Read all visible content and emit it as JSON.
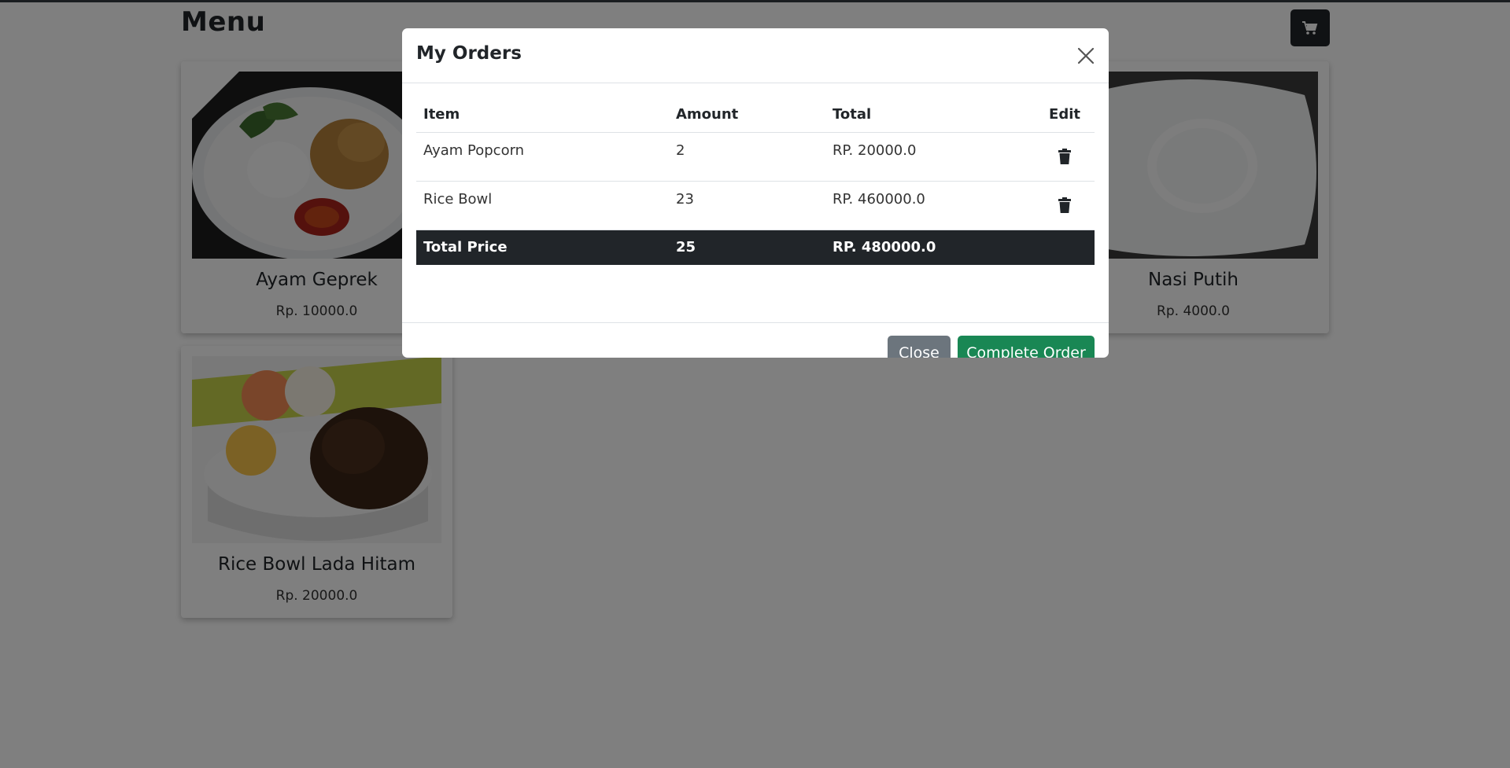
{
  "header": {
    "title": "Menu",
    "cart_icon": "cart-icon"
  },
  "menu_items": [
    {
      "name": "Ayam Geprek",
      "price": "Rp. 10000.0"
    },
    {
      "name": "Nasi Putih",
      "price": "Rp. 4000.0"
    },
    {
      "name": "Rice Bowl Lada Hitam",
      "price": "Rp. 20000.0"
    }
  ],
  "modal": {
    "title": "My Orders",
    "columns": {
      "item": "Item",
      "amount": "Amount",
      "total": "Total",
      "edit": "Edit"
    },
    "rows": [
      {
        "item": "Ayam Popcorn",
        "amount": "2",
        "total": "RP. 20000.0"
      },
      {
        "item": "Rice Bowl",
        "amount": "23",
        "total": "RP. 460000.0"
      }
    ],
    "summary": {
      "label": "Total Price",
      "amount": "25",
      "total": "RP. 480000.0"
    },
    "buttons": {
      "close": "Close",
      "complete": "Complete Order"
    }
  },
  "colors": {
    "dark": "#212529",
    "secondary": "#6c757d",
    "success": "#198754"
  }
}
